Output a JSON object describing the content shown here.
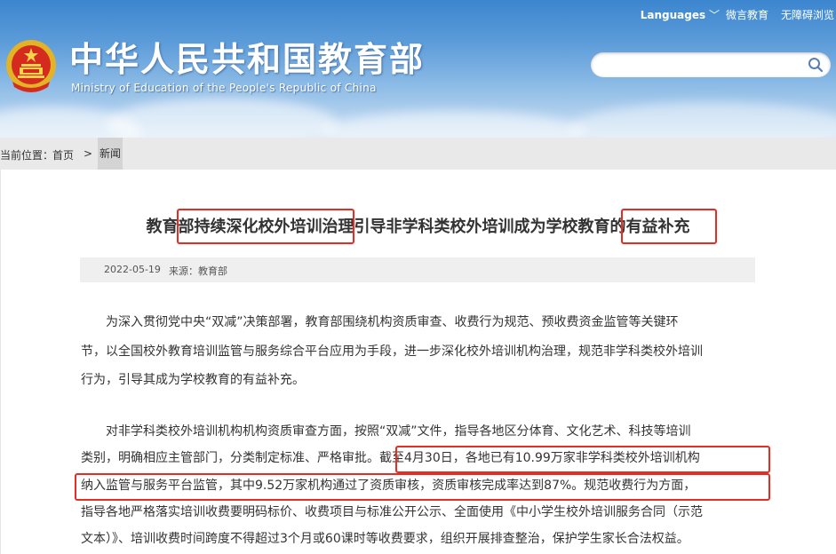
{
  "header": {
    "site_title": "中华人民共和国教育部",
    "site_subtitle": "Ministry of Education of the People's Republic of China",
    "languages_label": "Languages",
    "weibo_label": "微言教育",
    "accessibility_label": "无障碍浏览",
    "search": {
      "placeholder": "",
      "value": "",
      "icon": "search-icon"
    },
    "emblem_icon": "national-emblem-icon"
  },
  "breadcrumb": {
    "prefix": "当前位置：",
    "home": "首页",
    "separator": ">",
    "current": "新闻"
  },
  "article": {
    "title": {
      "part1": "教育部持续深化校外培训治理",
      "part2": "引导非学科类校外培训成为学校教育",
      "part3": "的有益补充"
    },
    "date": "2022-05-19",
    "source": "来源：教育部",
    "paragraph1": [
      "为深入贯彻党中央“双减”决策部署，教育部围绕机构资质审查、收费行为规范、预收费资金监管等关键环",
      "节，以全国校外教育培训监管与服务综合平台应用为手段，进一步深化校外培训机构治理，规范非学科类校外培训",
      "行为，引导其成为学校教育的有益补充。"
    ],
    "paragraph2": [
      "对非学科类校外培训机构机构资质审查方面，按照“双减”文件，指导各地区分体育、文化艺术、科技等培训",
      "类别，明确相应主管部门，分类制定标准、严格审批。截至4月30日，各地已有10.99万家非学科类校外培训机构",
      "纳入监管与服务平台监管，其中9.52万家机构通过了资质审核，资质审核完成率达到87%。规范收费行为方面，",
      "指导各地严格落实培训收费要明码标价、收费项目与标准公开公示、全面使用《中小学生校外培训服务合同（示范",
      "文本）》、培训收费时间跨度不得超过3个月或60课时等收费要求，组织开展排查整治，保护学生家长合法权益。"
    ]
  },
  "colors": {
    "highlight_border": "#e52d24",
    "header_top": "#3c86cf",
    "header_bottom": "#cfe2f4",
    "breadcrumb_bg": "#e9e9e9",
    "meta_bg": "#efefef",
    "text": "#333333"
  }
}
